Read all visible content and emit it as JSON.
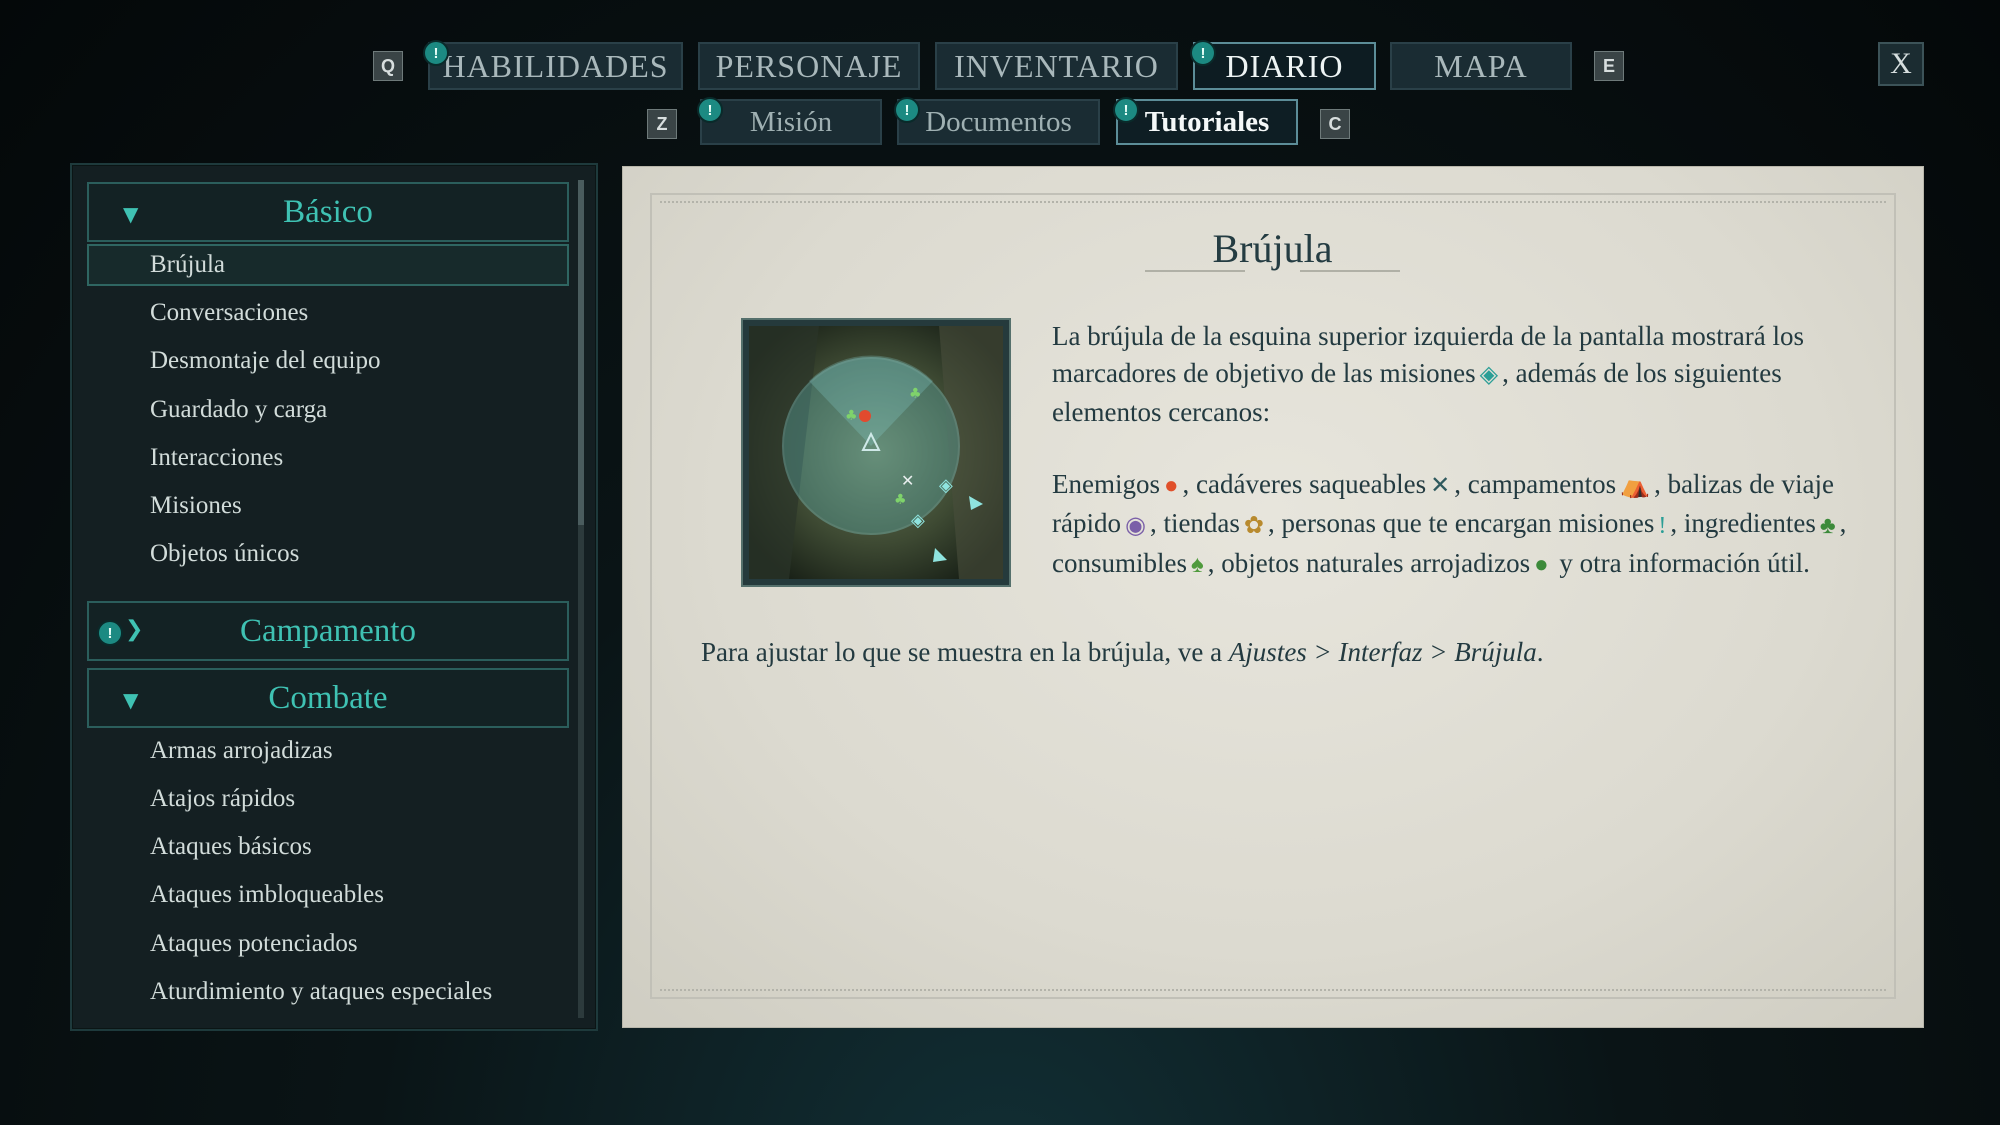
{
  "top_nav": {
    "key_left": "Q",
    "key_right": "E",
    "tabs": [
      {
        "label": "HABILIDADES",
        "has_alert": true
      },
      {
        "label": "PERSONAJE",
        "has_alert": false
      },
      {
        "label": "INVENTARIO",
        "has_alert": false
      },
      {
        "label": "DIARIO",
        "has_alert": true,
        "active": true
      },
      {
        "label": "MAPA",
        "has_alert": false
      }
    ],
    "close_label": "X"
  },
  "sub_nav": {
    "key_left": "Z",
    "key_right": "C",
    "tabs": [
      {
        "label": "Misión",
        "has_alert": true
      },
      {
        "label": "Documentos",
        "has_alert": true
      },
      {
        "label": "Tutoriales",
        "has_alert": true,
        "active": true
      }
    ]
  },
  "alert_glyph": "!",
  "sidebar": {
    "categories": [
      {
        "label": "Básico",
        "expanded": true,
        "items": [
          "Brújula",
          "Conversaciones",
          "Desmontaje del equipo",
          "Guardado y carga",
          "Interacciones",
          "Misiones",
          "Objetos únicos"
        ]
      },
      {
        "label": "Campamento",
        "expanded": false,
        "has_alert": true,
        "items": []
      },
      {
        "label": "Combate",
        "expanded": true,
        "items": [
          "Armas arrojadizas",
          "Atajos rápidos",
          "Ataques básicos",
          "Ataques imbloqueables",
          "Ataques potenciados",
          "Aturdimiento y ataques especiales"
        ]
      }
    ],
    "selected_item": "Brújula"
  },
  "article": {
    "title": "Brújula",
    "intro": "La brújula de la esquina superior izquierda de la pantalla mostrará los marcadores de objetivo de las misiones",
    "intro_tail": ", además de los siguientes elementos cercanos:",
    "list_parts": {
      "p1": "Enemigos",
      "p2": ", cadáveres saqueables",
      "p3": ", campamentos",
      "p4": ", balizas de viaje rápido",
      "p5": ", tiendas",
      "p6": ", personas que te encargan misiones",
      "p7": ", ingredientes",
      "p8": ", consumibles",
      "p9": ", objetos naturales arrojadizos",
      "p10": " y otra información útil."
    },
    "footer_pre": "Para ajustar lo que se muestra en la brújula, ve a ",
    "footer_path": "Ajustes > Interfaz > Brújula",
    "footer_post": "."
  },
  "colors": {
    "accent_teal": "#3fc2b3",
    "parchment": "#e2e0d6",
    "text_dark": "#233a40"
  }
}
